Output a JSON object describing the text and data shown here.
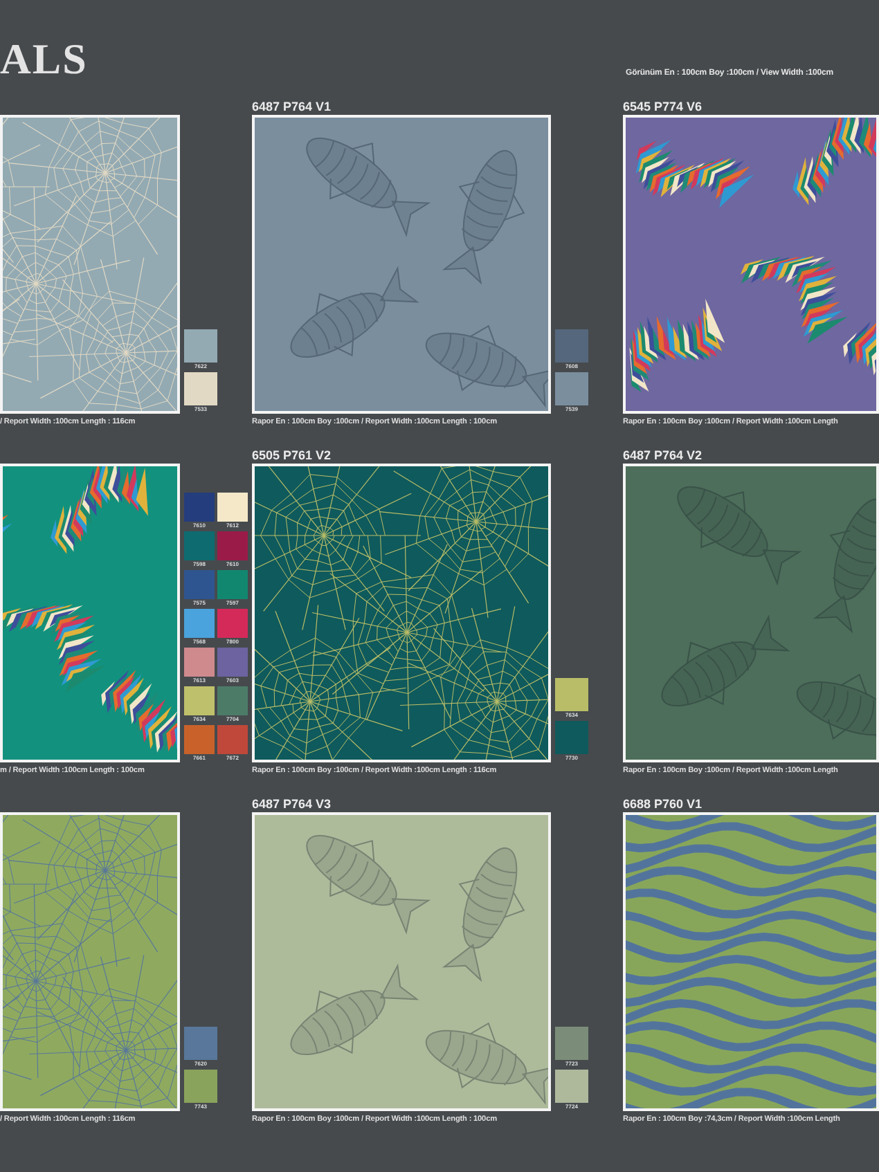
{
  "header": {
    "title": "ALS",
    "view_size": "Görünüm  En : 100cm  Boy :100cm / View Width :100cm"
  },
  "rows": [
    {
      "products": [
        {
          "kind": "web",
          "color": "#93aab3",
          "swatches": [
            {
              "code": "7622",
              "color": "#93aab3"
            },
            {
              "code": "7533",
              "color": "#e2d9c4"
            }
          ],
          "caption": "/ Report Width :100cm  Length  : 116cm"
        },
        {
          "code": "6487 P764 V1",
          "kind": "koi",
          "color": "#7a8e9e",
          "swatches": [
            {
              "code": "7608",
              "color": "#55677c"
            },
            {
              "code": "7539",
              "color": "#7a8e9e"
            }
          ],
          "caption": "Rapor En : 100cm  Boy :100cm / Report Width :100cm  Length  : 100cm"
        },
        {
          "code": "6545 P774 V6",
          "kind": "feathers",
          "color": "#6e67a0",
          "caption": "Rapor En : 100cm  Boy :100cm / Report Width :100cm  Length"
        }
      ]
    },
    {
      "products": [
        {
          "kind": "feathers",
          "color": "#12927e",
          "swatches": [
            {
              "code": "7610",
              "color": "#243d7c"
            },
            {
              "code": "7612",
              "color": "#f4e8c8"
            },
            {
              "code": "7598",
              "color": "#0e6b70"
            },
            {
              "code": "7610",
              "color": "#9a1b48"
            },
            {
              "code": "7575",
              "color": "#2f5590"
            },
            {
              "code": "7597",
              "color": "#12876f"
            },
            {
              "code": "7568",
              "color": "#4aa3dc"
            },
            {
              "code": "7800",
              "color": "#d42a5a"
            },
            {
              "code": "7613",
              "color": "#cf8a8e"
            },
            {
              "code": "7603",
              "color": "#6c63a0"
            },
            {
              "code": "7634",
              "color": "#bfc06b"
            },
            {
              "code": "7704",
              "color": "#4c7c68"
            },
            {
              "code": "7661",
              "color": "#c9622a"
            },
            {
              "code": "7672",
              "color": "#c0483a"
            }
          ],
          "caption": "m / Report Width :100cm  Length  : 100cm"
        },
        {
          "code": "6505 P761 V2",
          "kind": "web",
          "color": "#0f5a5c",
          "swatches": [
            {
              "code": "7634",
              "color": "#b9bd68"
            },
            {
              "code": "7730",
              "color": "#0f5a5c"
            }
          ],
          "caption": "Rapor En : 100cm  Boy :100cm / Report Width :100cm  Length  : 116cm"
        },
        {
          "code": "6487 P764 V2",
          "kind": "koi",
          "color": "#4d6e5a",
          "caption": "Rapor En : 100cm  Boy :100cm / Report Width :100cm  Length"
        }
      ]
    },
    {
      "products": [
        {
          "kind": "web",
          "color": "#8faa5f",
          "swatches": [
            {
              "code": "7620",
              "color": "#58779a"
            },
            {
              "code": "7743",
              "color": "#8aa35c"
            }
          ],
          "caption": "/ Report Width :100cm  Length  : 116cm"
        },
        {
          "code": "6487 P764 V3",
          "kind": "koi",
          "color": "#aebb9b",
          "swatches": [
            {
              "code": "7723",
              "color": "#7b8d79"
            },
            {
              "code": "7724",
              "color": "#aeb99c"
            }
          ],
          "caption": "Rapor En : 100cm  Boy :100cm / Report Width :100cm  Length  : 100cm"
        },
        {
          "code": "6688 P760 V1",
          "kind": "zebra",
          "color": "#88a65a",
          "caption": "Rapor En : 100cm  Boy :74,3cm / Report Width :100cm  Length"
        }
      ]
    }
  ]
}
